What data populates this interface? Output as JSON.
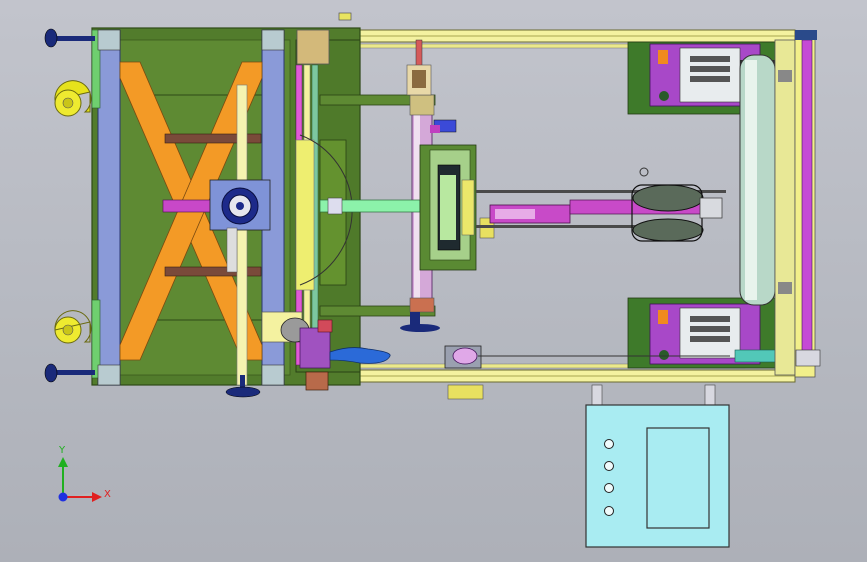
{
  "triad": {
    "x_label": "X",
    "y_label": "Y",
    "x_color": "#e02020",
    "y_color": "#20b020",
    "z_color": "#2030e0"
  },
  "palette": {
    "background": "#b9bcc4",
    "frame_olive": "#4f7a2a",
    "frame_yellow": "#f2ef8a",
    "rail_blue": "#7d8fd6",
    "brace_orange": "#f2921e",
    "magenta": "#d05bd3",
    "shaft_green": "#8af0a8",
    "control_cabinet": "#a9ecf2",
    "caster_yellow": "#e8e41a",
    "foot_navy": "#1a2a7a"
  },
  "control_cabinet": {
    "indicator_count": 4
  }
}
